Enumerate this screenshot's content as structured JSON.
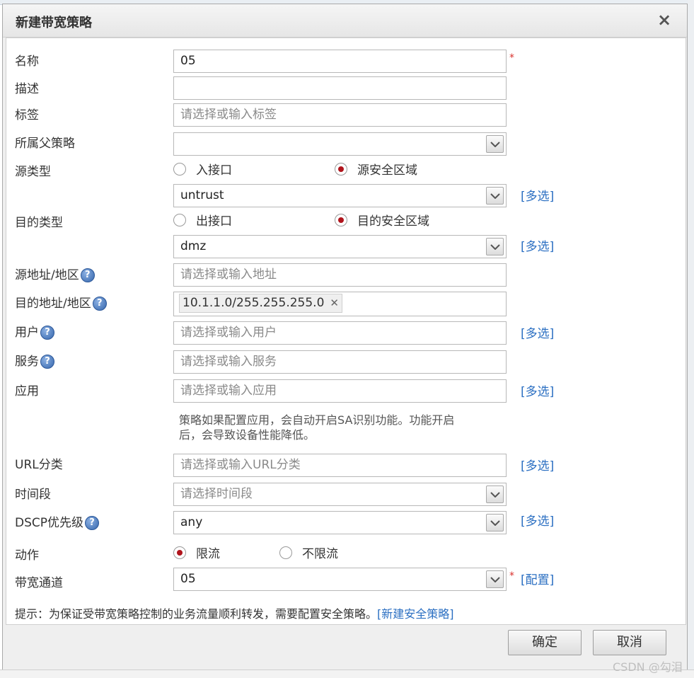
{
  "dialog": {
    "title": "新建带宽策略",
    "close_glyph": "×"
  },
  "form": {
    "name": {
      "label": "名称",
      "value": "05",
      "required": "*"
    },
    "description": {
      "label": "描述",
      "value": ""
    },
    "tags": {
      "label": "标签",
      "placeholder": "请选择或输入标签"
    },
    "parent_policy": {
      "label": "所属父策略",
      "value": ""
    },
    "source_type": {
      "label": "源类型",
      "options": [
        "入接口",
        "源安全区域"
      ],
      "selected": "源安全区域",
      "zone_value": "untrust",
      "multi_link": "[多选]"
    },
    "dest_type": {
      "label": "目的类型",
      "options": [
        "出接口",
        "目的安全区域"
      ],
      "selected": "目的安全区域",
      "zone_value": "dmz",
      "multi_link": "[多选]"
    },
    "source_address": {
      "label": "源地址/地区",
      "placeholder": "请选择或输入地址"
    },
    "dest_address": {
      "label": "目的地址/地区",
      "tag": "10.1.1.0/255.255.255.0",
      "tag_remove": "✕"
    },
    "user": {
      "label": "用户",
      "placeholder": "请选择或输入用户",
      "multi_link": "[多选]"
    },
    "service": {
      "label": "服务",
      "placeholder": "请选择或输入服务"
    },
    "application": {
      "label": "应用",
      "placeholder": "请选择或输入应用",
      "multi_link": "[多选]",
      "note_line1": "策略如果配置应用，会自动开启SA识别功能。功能开启",
      "note_line2": "后，会导致设备性能降低。"
    },
    "url_category": {
      "label": "URL分类",
      "placeholder": "请选择或输入URL分类",
      "multi_link": "[多选]"
    },
    "time_range": {
      "label": "时间段",
      "placeholder": "请选择时间段"
    },
    "dscp": {
      "label": "DSCP优先级",
      "value": "any",
      "multi_link": "[多选]"
    },
    "action": {
      "label": "动作",
      "options": [
        "限流",
        "不限流"
      ],
      "selected": "限流"
    },
    "bandwidth_channel": {
      "label": "带宽通道",
      "value": "05",
      "required": "*",
      "config_link": "[配置]"
    },
    "help_glyph": "?"
  },
  "hint": {
    "text": "提示：为保证受带宽策略控制的业务流量顺利转发，需要配置安全策略。",
    "link": "[新建安全策略]"
  },
  "buttons": {
    "ok": "确定",
    "cancel": "取消"
  },
  "watermark": "CSDN @勾泪",
  "colors": {
    "link": "#2b6fc2",
    "required": "#d9302c",
    "radio_selected": "#b0141c"
  }
}
